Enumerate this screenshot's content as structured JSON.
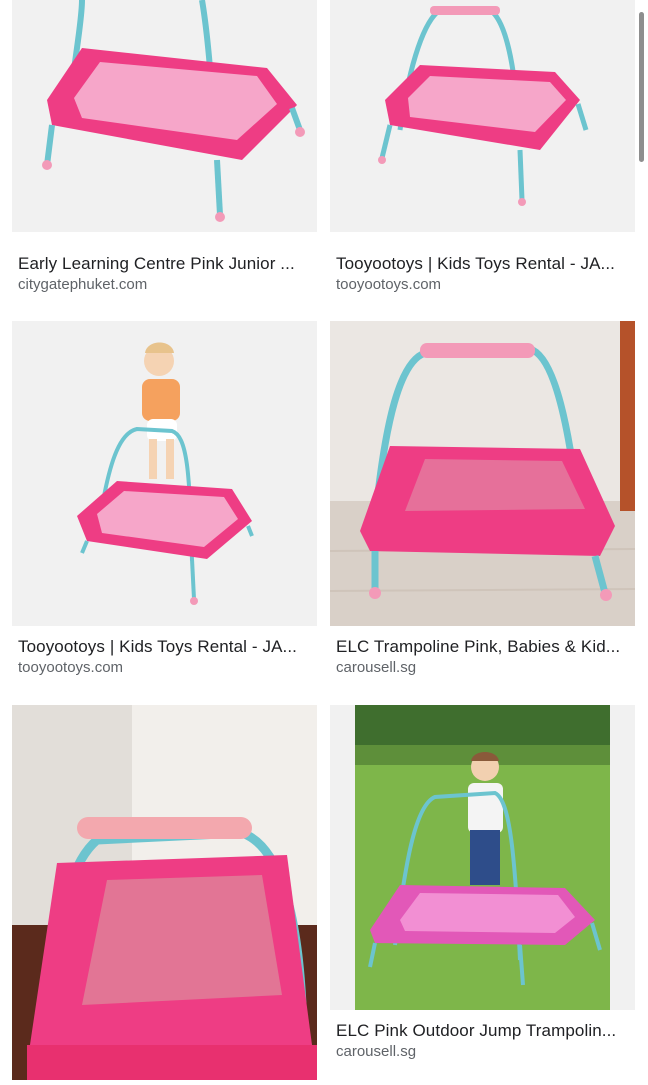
{
  "results": [
    {
      "title": "Early Learning Centre Pink Junior ...",
      "source": "citygatephuket.com",
      "image": "pink-trampoline-with-teal-bar"
    },
    {
      "title": "Tooyootoys | Kids Toys Rental - JA...",
      "source": "tooyootoys.com",
      "image": "pink-trampoline-with-teal-bar"
    },
    {
      "title": "Tooyootoys | Kids Toys Rental - JA...",
      "source": "tooyootoys.com",
      "image": "toddler-on-pink-trampoline"
    },
    {
      "title": "ELC Trampoline Pink, Babies & Kid...",
      "source": "carousell.sg",
      "image": "pink-trampoline-indoors"
    },
    {
      "title": "",
      "source": "",
      "image": "pink-trampoline-closeup"
    },
    {
      "title": "ELC Pink Outdoor Jump Trampolin...",
      "source": "carousell.sg",
      "image": "toddler-on-trampoline-in-garden"
    }
  ],
  "colors": {
    "pink": "#ee3d84",
    "light_pink": "#f6a6c9",
    "teal": "#6cc4cf",
    "bar_pink": "#f39ab8"
  }
}
